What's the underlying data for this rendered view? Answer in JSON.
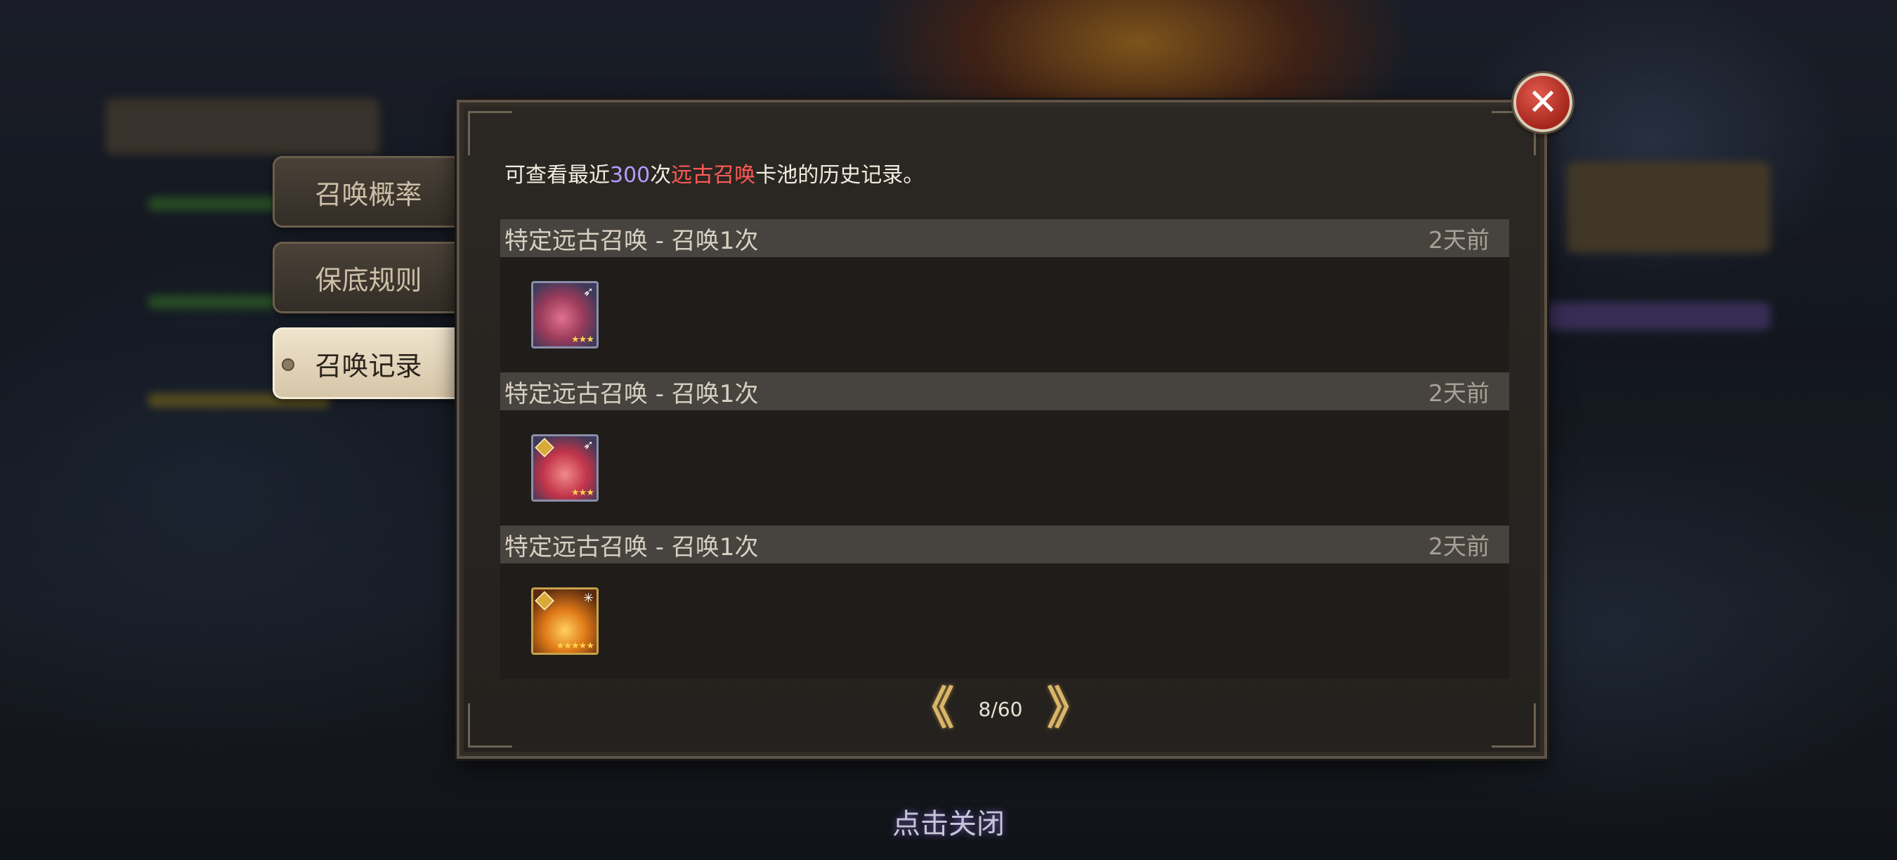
{
  "tabs": [
    {
      "label": "召唤概率",
      "active": false
    },
    {
      "label": "保底规则",
      "active": false
    },
    {
      "label": "召唤记录",
      "active": true
    }
  ],
  "description": {
    "prefix": "可查看最近",
    "count": "300",
    "mid": "次",
    "highlight": "远古召唤",
    "suffix": "卡池的历史记录。"
  },
  "records": [
    {
      "title": "特定远古召唤 - 召唤1次",
      "time": "2天前",
      "hero": {
        "stars": "★★★",
        "class_icon": "bow-icon"
      }
    },
    {
      "title": "特定远古召唤 - 召唤1次",
      "time": "2天前",
      "hero": {
        "stars": "★★★",
        "class_icon": "bow-icon"
      }
    },
    {
      "title": "特定远古召唤 - 召唤1次",
      "time": "2天前",
      "hero": {
        "stars": "★★★★★",
        "class_icon": "staff-icon"
      }
    }
  ],
  "pager": {
    "page": "8/60",
    "prev": "《",
    "next": "》"
  },
  "close_hint": "点击关闭",
  "colors": {
    "count": "#b49cff",
    "highlight": "#ff5a55"
  }
}
